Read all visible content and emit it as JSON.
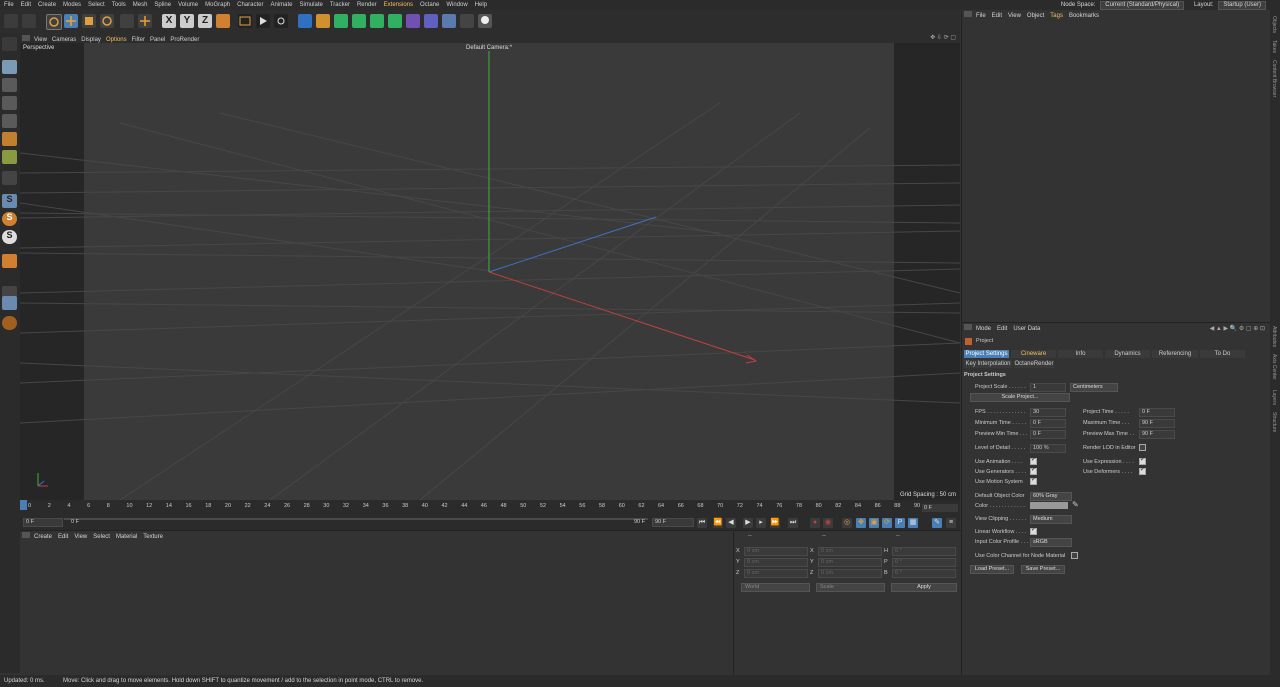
{
  "menubar": {
    "items": [
      "File",
      "Edit",
      "Create",
      "Modes",
      "Select",
      "Tools",
      "Mesh",
      "Spline",
      "Volume",
      "MoGraph",
      "Character",
      "Animate",
      "Simulate",
      "Tracker",
      "Render",
      "Extensions",
      "Octane",
      "Window",
      "Help"
    ],
    "node_space_label": "Node Space:",
    "node_space_value": "Current (Standard/Physical)",
    "layout_label": "Layout:",
    "layout_value": "Startup (User)"
  },
  "viewport": {
    "menu": [
      "View",
      "Cameras",
      "Display",
      "Options",
      "Filter",
      "Panel",
      "ProRender"
    ],
    "projection": "Perspective",
    "camera": "Default Camera",
    "camera_suffix": ":*",
    "grid_spacing": "Grid Spacing : 50 cm"
  },
  "timeline": {
    "ticks": [
      "0",
      "2",
      "4",
      "6",
      "8",
      "10",
      "12",
      "14",
      "16",
      "18",
      "20",
      "22",
      "24",
      "26",
      "28",
      "30",
      "32",
      "34",
      "36",
      "38",
      "40",
      "42",
      "44",
      "46",
      "48",
      "50",
      "52",
      "54",
      "56",
      "58",
      "60",
      "62",
      "64",
      "66",
      "68",
      "70",
      "72",
      "74",
      "76",
      "78",
      "80",
      "82",
      "84",
      "86",
      "88",
      "90"
    ],
    "current_frame": "0 F",
    "end_frame_right": "0 F",
    "start_field": "0 F",
    "range_start": "0 F",
    "range_end": "90 F",
    "max_field": "90 F"
  },
  "material_manager": {
    "menu": [
      "Create",
      "Edit",
      "View",
      "Select",
      "Material",
      "Texture"
    ]
  },
  "coordinates": {
    "header": "--",
    "rows": [
      {
        "a": "X",
        "av": "0 cm",
        "b": "X",
        "bv": "0 cm",
        "c": "H",
        "cv": "0 °"
      },
      {
        "a": "Y",
        "av": "0 cm",
        "b": "Y",
        "bv": "0 cm",
        "c": "P",
        "cv": "0 °"
      },
      {
        "a": "Z",
        "av": "0 cm",
        "b": "Z",
        "bv": "0 cm",
        "c": "B",
        "cv": "0 °"
      }
    ],
    "world": "World",
    "scale": "Scale",
    "apply": "Apply"
  },
  "object_manager": {
    "menu": [
      "File",
      "Edit",
      "View",
      "Object",
      "Tags",
      "Bookmarks"
    ]
  },
  "attribute_manager": {
    "menu": [
      "Mode",
      "Edit",
      "User Data"
    ],
    "title": "Project",
    "tabs": [
      "Project Settings",
      "Cineware",
      "Info",
      "Dynamics",
      "Referencing",
      "To Do"
    ],
    "tabs2": [
      "Key Interpolation",
      "OctaneRender"
    ],
    "section": "Project Settings",
    "project_scale_label": "Project Scale . . . . . .",
    "project_scale_value": "1",
    "project_scale_unit": "Centimeters",
    "scale_project_btn": "Scale Project...",
    "fps_label": "FPS . . . . . . . . . . . . .",
    "fps_value": "30",
    "project_time_label": "Project Time . . . . .",
    "project_time_value": "0 F",
    "min_time_label": "Minimum Time . . . . .",
    "min_time_value": "0 F",
    "max_time_label": "Maximum Time . . .",
    "max_time_value": "90 F",
    "prev_min_label": "Preview Min Time . . .",
    "prev_min_value": "0 F",
    "prev_max_label": "Preview Max Time . .",
    "prev_max_value": "90 F",
    "lod_label": "Level of Detail . . . . .",
    "lod_value": "100 %",
    "render_lod_label": "Render LOD in Editor",
    "use_anim_label": "Use Animation . . . .",
    "use_expr_label": "Use Expression . . . .",
    "use_gen_label": "Use Generators . . . .",
    "use_def_label": "Use Deformers . . . .",
    "use_motion_label": "Use Motion System",
    "def_obj_color_label": "Default Object Color",
    "def_obj_color_value": "60% Gray",
    "color_label": "Color . . . . . . . . . . . .",
    "view_clip_label": "View Clipping . . . . . .",
    "view_clip_value": "Medium",
    "linear_wf_label": "Linear Workflow . . . .",
    "input_cp_label": "Input Color Profile . . .",
    "input_cp_value": "sRGB",
    "use_color_channel_label": "Use Color Channel for Node Material",
    "load_preset": "Load Preset...",
    "save_preset": "Save Preset..."
  },
  "right_strip": [
    "Objects",
    "Takes",
    "Content Browser",
    "Attributes",
    "Axis Center",
    "Layers",
    "Structure"
  ],
  "status": {
    "updated": "Updated: 0 ms.",
    "message": "Move: Click and drag to move elements. Hold down SHIFT to quantize movement / add to the selection in point mode, CTRL to remove."
  },
  "colors": {
    "accent": "#f0c060",
    "selected": "#4a7fb5",
    "axis_x": "#c04040",
    "axis_y": "#40b040",
    "axis_z": "#4070c0"
  }
}
